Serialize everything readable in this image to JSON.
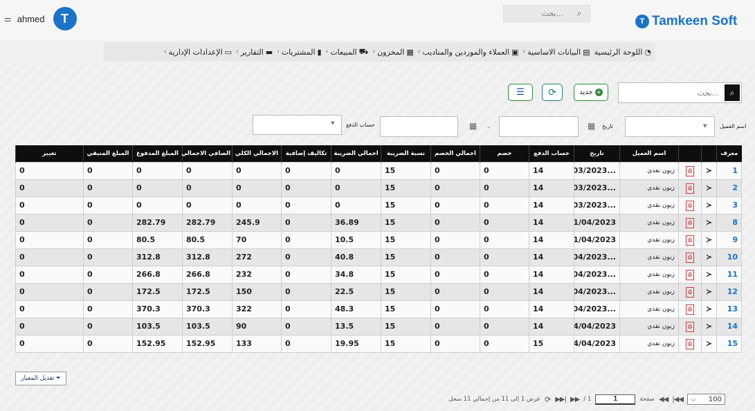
{
  "header": {
    "username": "ahmed",
    "search_placeholder": "بحث...",
    "brand_name": "Tamkeen Soft",
    "brand_mark": "T"
  },
  "nav": [
    {
      "label": "اللوحة الرئيسية",
      "icon": "dashboard-icon",
      "chevron": false
    },
    {
      "label": "البيانات الاساسية",
      "icon": "table-icon",
      "chevron": true
    },
    {
      "label": "العملاء والموردين والمناديب",
      "icon": "contact-card-icon",
      "chevron": true
    },
    {
      "label": "المخزون",
      "icon": "grid-icon",
      "chevron": true
    },
    {
      "label": "المبيعات",
      "icon": "cart-icon",
      "chevron": true
    },
    {
      "label": "المشتريات",
      "icon": "document-icon",
      "chevron": true
    },
    {
      "label": "التقارير",
      "icon": "folder-icon",
      "chevron": true
    },
    {
      "label": "الإعدادات الإدارية",
      "icon": "monitor-icon",
      "chevron": true
    }
  ],
  "toolbar": {
    "search_placeholder": "بحث...",
    "new_label": "جديد"
  },
  "filters": {
    "customer_label": "اسم العميل",
    "date_label": "تاريخ",
    "payment_account_label": "حساب الدفع",
    "date_separator": "-"
  },
  "table": {
    "columns": [
      "معرف",
      "",
      "",
      "اسم العميل",
      "تاريخ",
      "حساب الدفع",
      "خصم",
      "اجمالي الخصم",
      "نسبة الضريبة",
      "اجمالي الضريبة",
      "تكاليف إضافية",
      "الاجمالي الكلي",
      "الصافي الاجمالي",
      "المبلغ المدفوع",
      "المبلغ المتبقي",
      "تغيير"
    ],
    "rows": [
      [
        "1",
        "زبون نقدي",
        "...03/2023/",
        "14",
        "0",
        "0",
        "15",
        "0",
        "0",
        "0",
        "0",
        "0",
        "0",
        "0"
      ],
      [
        "2",
        "زبون نقدي",
        "...03/2023/",
        "14",
        "0",
        "0",
        "15",
        "0",
        "0",
        "0",
        "0",
        "0",
        "0",
        "0"
      ],
      [
        "3",
        "زبون نقدي",
        "...03/2023/",
        "14",
        "0",
        "0",
        "15",
        "0",
        "0",
        "0",
        "0",
        "0",
        "0",
        "0"
      ],
      [
        "8",
        "زبون نقدي",
        "01/04/2023",
        "14",
        "0",
        "0",
        "15",
        "36.89",
        "0",
        "245.9",
        "282.79",
        "282.79",
        "0",
        "0"
      ],
      [
        "9",
        "زبون نقدي",
        "01/04/2023",
        "14",
        "0",
        "0",
        "15",
        "10.5",
        "0",
        "70",
        "80.5",
        "80.5",
        "0",
        "0"
      ],
      [
        "10",
        "زبون نقدي",
        "...04/2023/",
        "14",
        "0",
        "0",
        "15",
        "40.8",
        "0",
        "272",
        "312.8",
        "312.8",
        "0",
        "0"
      ],
      [
        "11",
        "زبون نقدي",
        "...04/2023/",
        "14",
        "0",
        "0",
        "15",
        "34.8",
        "0",
        "232",
        "266.8",
        "266.8",
        "0",
        "0"
      ],
      [
        "12",
        "زبون نقدي",
        "...04/2023/",
        "14",
        "0",
        "0",
        "15",
        "22.5",
        "0",
        "150",
        "172.5",
        "172.5",
        "0",
        "0"
      ],
      [
        "13",
        "زبون نقدي",
        "...04/2023/",
        "14",
        "0",
        "0",
        "15",
        "48.3",
        "0",
        "322",
        "370.3",
        "370.3",
        "0",
        "0"
      ],
      [
        "14",
        "زبون نقدي",
        "14/04/2023",
        "14",
        "0",
        "0",
        "15",
        "13.5",
        "0",
        "90",
        "103.5",
        "103.5",
        "0",
        "0"
      ],
      [
        "15",
        "زبون نقدي",
        "14/04/2023",
        "15",
        "0",
        "0",
        "15",
        "19.95",
        "0",
        "133",
        "152.95",
        "152.95",
        "0",
        "0"
      ]
    ]
  },
  "edit_criteria_label": "تعديل المعيار",
  "pager": {
    "page_size": "100",
    "page_label": "صفحة",
    "current_page": "1",
    "total_pages": "/ 1",
    "summary": "عرض 1 إلى 11 من إجمالي 11 سجل"
  },
  "colors": {
    "brand": "#1a73c8",
    "header_bg": "#0e0e0e",
    "share_green": "#2e8b3a",
    "pdf_red": "#d43a3a"
  }
}
